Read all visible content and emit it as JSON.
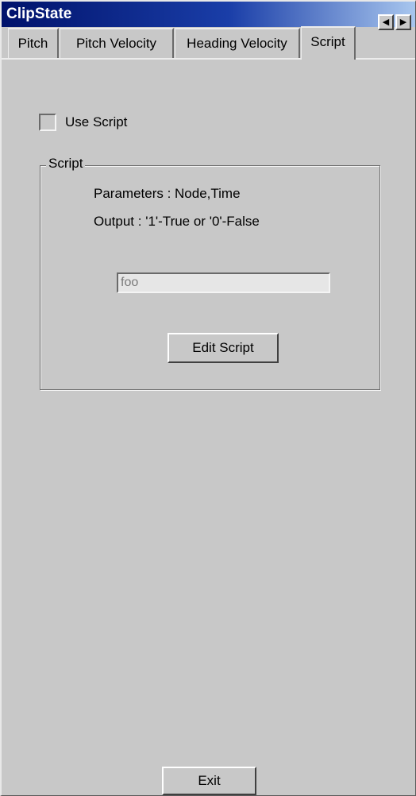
{
  "window": {
    "title": "ClipState"
  },
  "tabs": [
    {
      "label": "Pitch",
      "active": false
    },
    {
      "label": "Pitch Velocity",
      "active": false
    },
    {
      "label": "Heading Velocity",
      "active": false
    },
    {
      "label": "Script",
      "active": true
    }
  ],
  "tab_scroll": {
    "left_icon": "◀",
    "right_icon": "▶"
  },
  "use_script": {
    "label": "Use Script",
    "checked": false
  },
  "script_group": {
    "legend": "Script",
    "parameters_text": "Parameters :  Node,Time",
    "output_text": "Output : '1'-True or '0'-False",
    "script_field_value": "foo",
    "edit_button_label": "Edit Script"
  },
  "footer": {
    "exit_button_label": "Exit"
  },
  "icons": {
    "tab_scroll_left": "triangle-left-icon",
    "tab_scroll_right": "triangle-right-icon"
  }
}
